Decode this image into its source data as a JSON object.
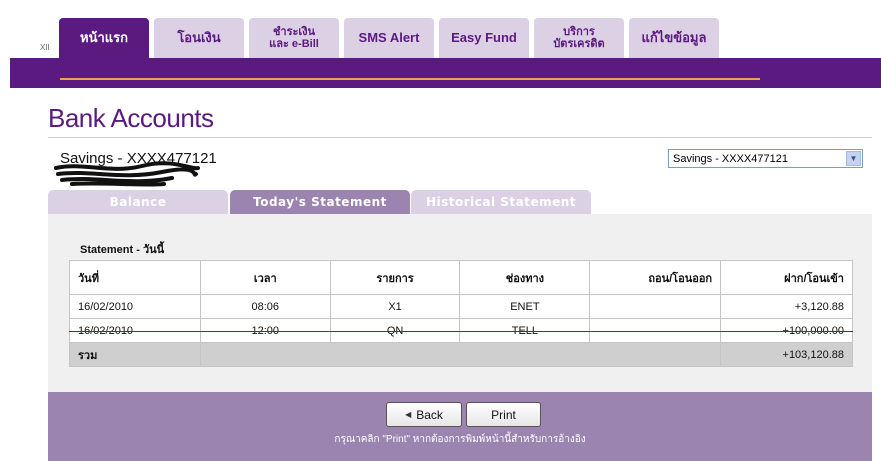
{
  "nav": {
    "corner_text": "XII",
    "tabs": [
      {
        "label": "หน้าแรก",
        "active": true
      },
      {
        "label": "โอนเงิน",
        "active": false
      },
      {
        "label": "ชำระเงิน\nและ e-Bill",
        "active": false
      },
      {
        "label": "SMS Alert",
        "active": false
      },
      {
        "label": "Easy Fund",
        "active": false
      },
      {
        "label": "บริการ\nบัตรเครดิต",
        "active": false
      },
      {
        "label": "แก้ไขข้อมูล",
        "active": false
      }
    ]
  },
  "page": {
    "title": "Bank Accounts",
    "account_label": "Savings - XXXX477121",
    "account_select": "Savings - XXXX477121"
  },
  "subtabs": [
    {
      "label": "Balance",
      "active": false
    },
    {
      "label": "Today's Statement",
      "active": true
    },
    {
      "label": "Historical Statement",
      "active": false
    }
  ],
  "statement": {
    "title": "Statement - วันนี้",
    "columns": [
      "วันที่",
      "เวลา",
      "รายการ",
      "ช่องทาง",
      "ถอน/โอนออก",
      "ฝาก/โอนเข้า"
    ],
    "rows": [
      {
        "date": "16/02/2010",
        "time": "08:06",
        "item": "X1",
        "channel": "ENET",
        "withdraw": "",
        "deposit": "+3,120.88",
        "cancelled": false
      },
      {
        "date": "16/02/2010",
        "time": "12:00",
        "item": "QN",
        "channel": "TELL",
        "withdraw": "",
        "deposit": "+100,000.00",
        "cancelled": true
      }
    ],
    "total_label": "รวม",
    "total_value": "+103,120.88"
  },
  "footer": {
    "back_label": "Back",
    "print_label": "Print",
    "print_note": "กรุณาคลิก \"Print\" หากต้องการพิมพ์หน้านี้สำหรับการอ้างอิง"
  },
  "colors": {
    "brand_purple": "#5b1a7f",
    "tab_light": "#dcd0e4",
    "subtab_active": "#9b84b0",
    "strike_red": "#cc0000",
    "accent_orange": "#f0a050"
  }
}
